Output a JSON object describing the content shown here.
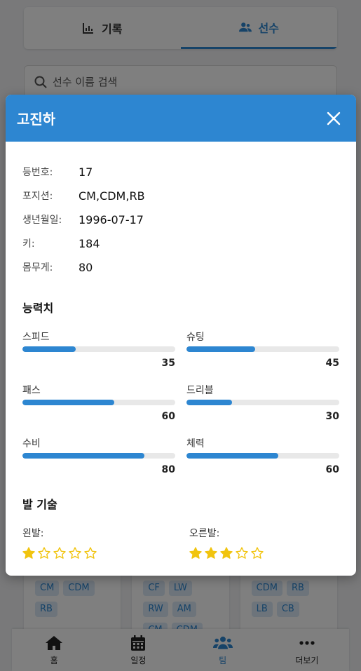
{
  "tabs": [
    {
      "label": "기록",
      "icon": "chart-icon",
      "active": false
    },
    {
      "label": "선수",
      "icon": "users-icon",
      "active": true
    }
  ],
  "search": {
    "placeholder": "선수 이름 검색"
  },
  "player_cards": [
    {
      "positions": [
        "CM",
        "CDM",
        "RB"
      ]
    },
    {
      "positions": [
        "CF",
        "LW",
        "RW",
        "AM",
        "CM",
        "CDM"
      ]
    },
    {
      "positions": [
        "CDM",
        "RB",
        "LB",
        "CB"
      ]
    }
  ],
  "bottom_nav": [
    {
      "label": "홈",
      "icon": "home-icon"
    },
    {
      "label": "일정",
      "icon": "calendar-icon"
    },
    {
      "label": "팀",
      "icon": "team-icon",
      "active": true
    },
    {
      "label": "더보기",
      "icon": "more-icon"
    }
  ],
  "modal": {
    "title": "고진하",
    "info": [
      {
        "label": "등번호:",
        "value": "17"
      },
      {
        "label": "포지션:",
        "value": "CM,CDM,RB"
      },
      {
        "label": "생년월일:",
        "value": "1996-07-17"
      },
      {
        "label": "키:",
        "value": "184"
      },
      {
        "label": "몸무게:",
        "value": "80"
      }
    ],
    "stats_title": "능력치",
    "stats": [
      {
        "name": "스피드",
        "value": 35
      },
      {
        "name": "슈팅",
        "value": 45
      },
      {
        "name": "패스",
        "value": 60
      },
      {
        "name": "드리블",
        "value": 30
      },
      {
        "name": "수비",
        "value": 80
      },
      {
        "name": "체력",
        "value": 60
      }
    ],
    "feet_title": "발 기술",
    "feet": [
      {
        "label": "왼발:",
        "rating": 1,
        "max": 5
      },
      {
        "label": "오른발:",
        "rating": 3,
        "max": 5
      }
    ],
    "colors": {
      "accent": "#2d86d1",
      "star": "#f1c40f"
    }
  }
}
